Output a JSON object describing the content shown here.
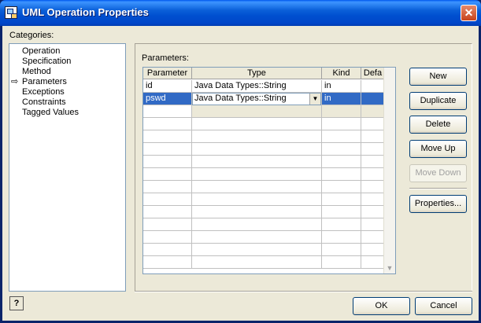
{
  "window": {
    "title": "UML Operation Properties"
  },
  "categories": {
    "label": "Categories:",
    "items": [
      "Operation",
      "Specification",
      "Method",
      "Parameters",
      "Exceptions",
      "Constraints",
      "Tagged Values"
    ],
    "selected_index": 3
  },
  "parameters": {
    "label": "Parameters:",
    "columns": [
      "Parameter",
      "Type",
      "Kind",
      "Defa"
    ],
    "rows": [
      {
        "parameter": "id",
        "type": "Java Data Types::String",
        "kind": "in",
        "default": ""
      },
      {
        "parameter": "pswd",
        "type": "Java Data Types::String",
        "kind": "in",
        "default": ""
      }
    ]
  },
  "buttons": {
    "new": "New",
    "duplicate": "Duplicate",
    "delete": "Delete",
    "move_up": "Move Up",
    "move_down": "Move Down",
    "properties": "Properties...",
    "ok": "OK",
    "cancel": "Cancel",
    "help": "?"
  },
  "icons": {
    "close": "close-icon",
    "help": "help-icon",
    "selection_arrow": "arrow-right-icon"
  }
}
